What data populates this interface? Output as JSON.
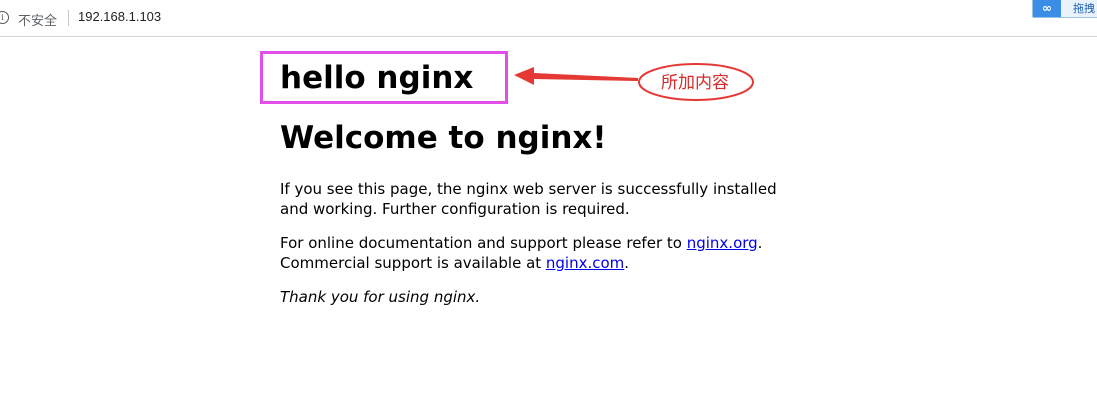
{
  "browser": {
    "security_label": "不安全",
    "url": "192.168.1.103",
    "extension_label": "拖拽"
  },
  "page": {
    "hello_heading": "hello nginx",
    "welcome_heading": "Welcome to nginx!",
    "paragraph1": "If you see this page, the nginx web server is successfully installed and working. Further configuration is required.",
    "paragraph2_part1": "For online documentation and support please refer to ",
    "link1": "nginx.org",
    "paragraph2_part2": ".",
    "paragraph2_part3": "Commercial support is available at ",
    "link2": "nginx.com",
    "paragraph2_part4": ".",
    "thanks": "Thank you for using nginx."
  },
  "annotation": {
    "label": "所加内容",
    "box_color": "#e24ee8",
    "callout_color": "#e53935"
  }
}
